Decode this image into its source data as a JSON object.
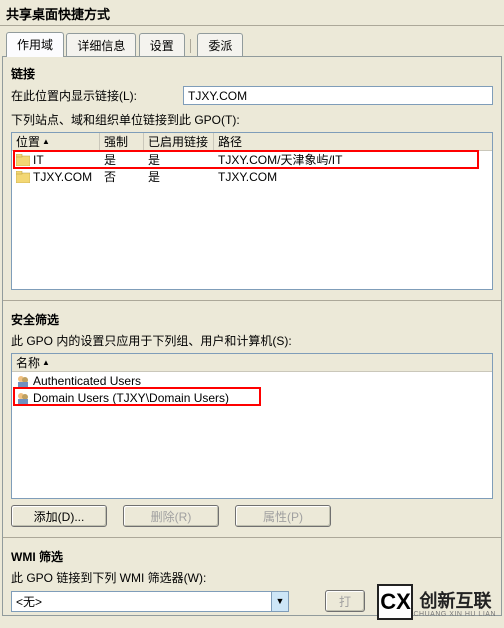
{
  "window": {
    "title": "共享桌面快捷方式"
  },
  "tabs": {
    "scope": "作用域",
    "details": "详细信息",
    "settings": "设置",
    "delegation": "委派"
  },
  "links": {
    "section_title": "链接",
    "display_label": "在此位置内显示链接(L):",
    "display_value": "TJXY.COM",
    "applies_label": "下列站点、域和组织单位链接到此 GPO(T):",
    "columns": {
      "location": "位置",
      "enforced": "强制",
      "enabled": "已启用链接",
      "path": "路径"
    },
    "rows": [
      {
        "location": "IT",
        "enforced": "是",
        "enabled": "是",
        "path": "TJXY.COM/天津象屿/IT"
      },
      {
        "location": "TJXY.COM",
        "enforced": "否",
        "enabled": "是",
        "path": "TJXY.COM"
      }
    ]
  },
  "security": {
    "section_title": "安全筛选",
    "applies_label": "此 GPO 内的设置只应用于下列组、用户和计算机(S):",
    "col_name": "名称",
    "rows": [
      {
        "name": "Authenticated Users"
      },
      {
        "name": "Domain Users (TJXY\\Domain Users)"
      }
    ],
    "buttons": {
      "add": "添加(D)...",
      "remove": "删除(R)",
      "properties": "属性(P)"
    }
  },
  "wmi": {
    "section_title": "WMI 筛选",
    "applies_label": "此 GPO 链接到下列 WMI 筛选器(W):",
    "selected": "<无>",
    "open": "打"
  },
  "watermark": {
    "logo": "CX",
    "text": "创新互联",
    "sub": "CHUANG XIN HU LIAN"
  }
}
